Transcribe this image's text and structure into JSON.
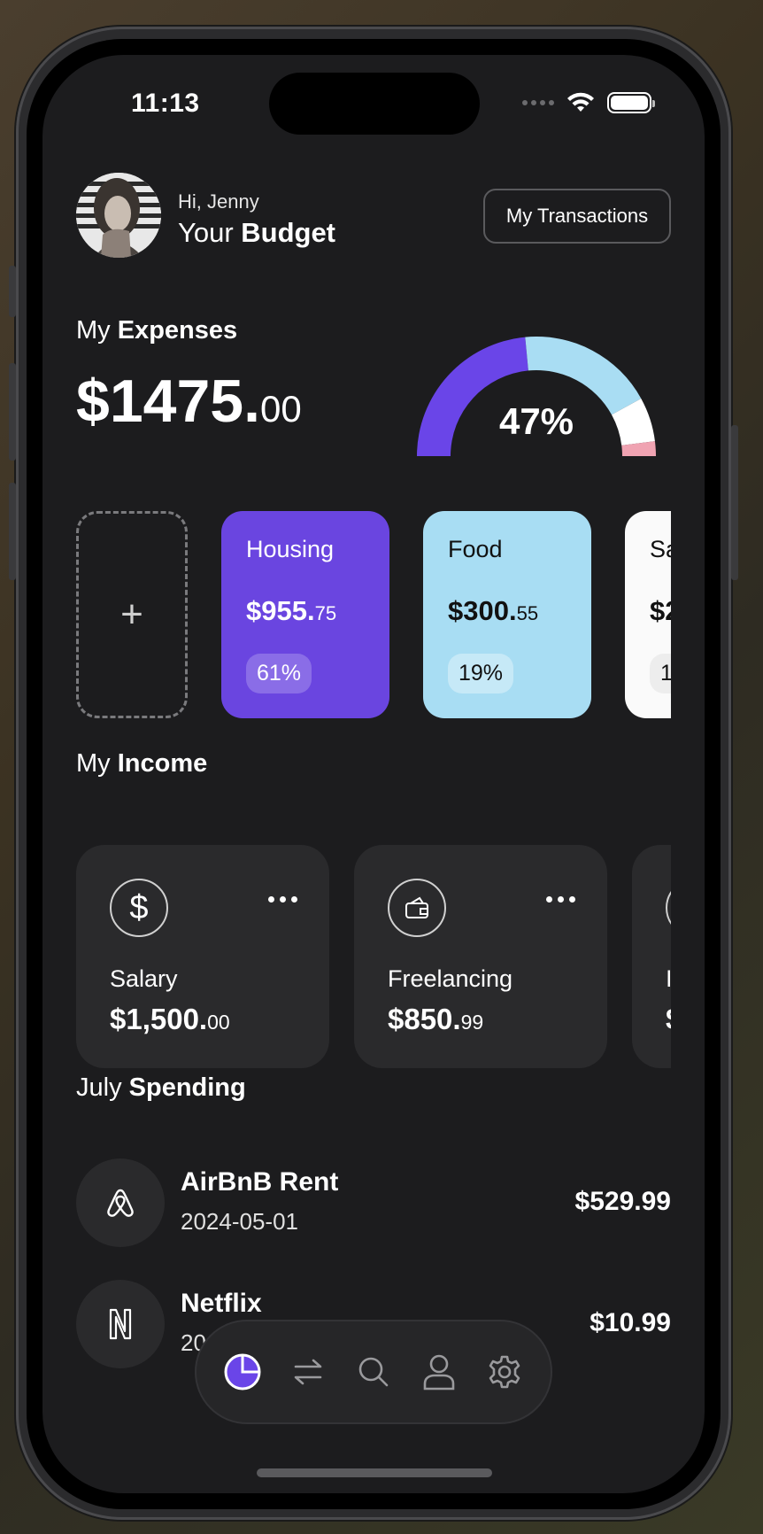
{
  "status_bar": {
    "time": "11:13"
  },
  "header": {
    "greeting": "Hi, Jenny",
    "title_prefix": "Your ",
    "title_bold": "Budget",
    "transactions_button": "My Transactions"
  },
  "expenses": {
    "title_prefix": "My ",
    "title_bold": "Expenses",
    "amount_main": "$1475.",
    "amount_cents": "00",
    "gauge_percent": "47%",
    "gauge_segments": [
      {
        "color": "#6a45e8",
        "fraction": 0.47
      },
      {
        "color": "#a9ddf3",
        "fraction": 0.37
      },
      {
        "color": "#ffffff",
        "fraction": 0.12
      },
      {
        "color": "#f0a3b2",
        "fraction": 0.04
      }
    ]
  },
  "categories": [
    {
      "name": "Housing",
      "amount_main": "$955.",
      "amount_cents": "75",
      "percent": "61%",
      "bg": "#6a45e0",
      "fg": "#ffffff",
      "chip_bg": "rgba(255,255,255,0.22)"
    },
    {
      "name": "Food",
      "amount_main": "$300.",
      "amount_cents": "55",
      "percent": "19%",
      "bg": "#a8ddf3",
      "fg": "#111111",
      "chip_bg": "rgba(255,255,255,0.35)"
    },
    {
      "name": "Sa",
      "amount_main": "$2",
      "amount_cents": "",
      "percent": "1",
      "bg": "#fafafa",
      "fg": "#111111",
      "chip_bg": "rgba(0,0,0,0.05)"
    }
  ],
  "add_category_label": "+",
  "income": {
    "title_prefix": "My ",
    "title_bold": "Income",
    "items": [
      {
        "icon": "dollar-icon",
        "name": "Salary",
        "amount_main": "$1,500.",
        "amount_cents": "00"
      },
      {
        "icon": "wallet-icon",
        "name": "Freelancing",
        "amount_main": "$850.",
        "amount_cents": "99"
      },
      {
        "icon": "circle-icon",
        "name": "I",
        "amount_main": "$",
        "amount_cents": ""
      }
    ]
  },
  "spending": {
    "title_prefix": "July ",
    "title_bold": "Spending",
    "items": [
      {
        "icon": "airbnb-icon",
        "name": "AirBnB Rent",
        "date": "2024-05-01",
        "amount": "$529.99"
      },
      {
        "icon": "netflix-icon",
        "name": "Netflix",
        "date": "20",
        "amount": "$10.99"
      }
    ]
  },
  "tabbar": {
    "items": [
      {
        "icon": "pie-chart-icon",
        "active": true
      },
      {
        "icon": "transfer-icon",
        "active": false
      },
      {
        "icon": "search-icon",
        "active": false
      },
      {
        "icon": "user-icon",
        "active": false
      },
      {
        "icon": "gear-icon",
        "active": false
      }
    ],
    "accent": "#6a45e8"
  }
}
